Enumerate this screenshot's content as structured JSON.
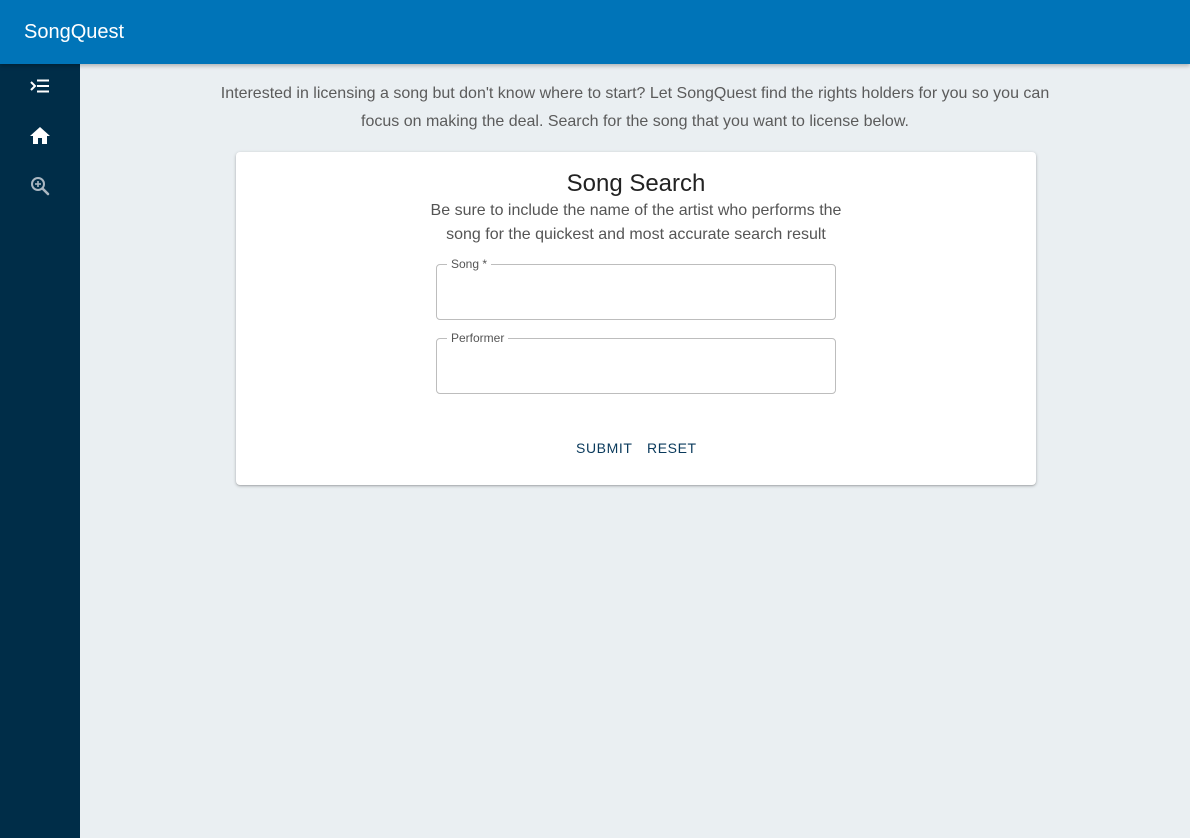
{
  "appbar": {
    "title": "SongQuest"
  },
  "sidebar": {
    "items": [
      {
        "icon": "menu-collapse-icon"
      },
      {
        "icon": "home-icon"
      },
      {
        "icon": "search-zoom-icon"
      }
    ]
  },
  "main": {
    "intro": "Interested in licensing a song but don't know where to start? Let SongQuest find the rights holders for you so you can focus on making the deal. Search for the song that you want to license below."
  },
  "search_card": {
    "title": "Song Search",
    "subtitle": "Be sure to include the name of the artist who performs the song for the quickest and most accurate search result",
    "song_label": "Song *",
    "song_value": "",
    "performer_label": "Performer",
    "performer_value": "",
    "submit_label": "SUBMIT",
    "reset_label": "RESET"
  },
  "colors": {
    "appbar": "#0074b8",
    "sidebar": "#002d48",
    "background": "#eaeff2",
    "button_text": "#0a3a5c"
  }
}
